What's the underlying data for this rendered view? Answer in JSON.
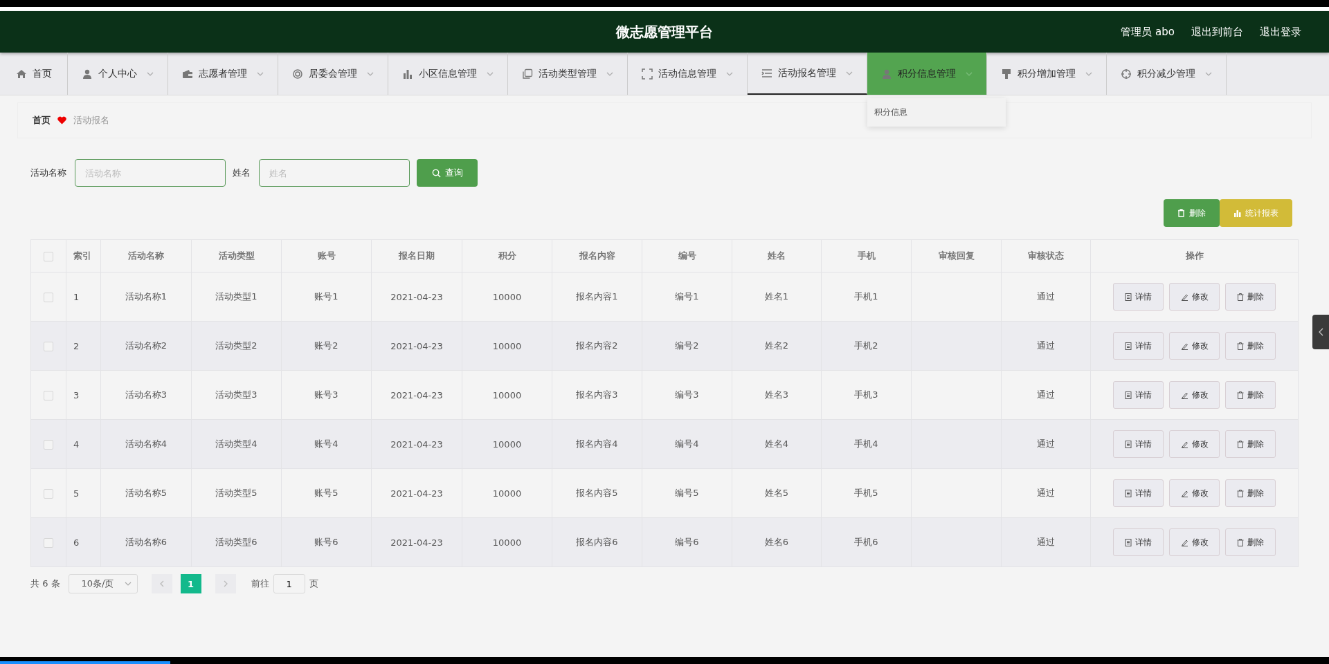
{
  "header": {
    "title": "微志愿管理平台",
    "user": "管理员 abo",
    "links": [
      "退出到前台",
      "退出登录"
    ]
  },
  "nav": [
    {
      "label": "首页",
      "has_caret": false,
      "selected": false,
      "highlighted": false
    },
    {
      "label": "个人中心",
      "has_caret": true,
      "selected": false,
      "highlighted": false
    },
    {
      "label": "志愿者管理",
      "has_caret": true,
      "selected": false,
      "highlighted": false
    },
    {
      "label": "居委会管理",
      "has_caret": true,
      "selected": false,
      "highlighted": false
    },
    {
      "label": "小区信息管理",
      "has_caret": true,
      "selected": false,
      "highlighted": false
    },
    {
      "label": "活动类型管理",
      "has_caret": true,
      "selected": false,
      "highlighted": false
    },
    {
      "label": "活动信息管理",
      "has_caret": true,
      "selected": false,
      "highlighted": false
    },
    {
      "label": "活动报名管理",
      "has_caret": true,
      "selected": true,
      "highlighted": false
    },
    {
      "label": "积分信息管理",
      "has_caret": true,
      "selected": false,
      "highlighted": true,
      "submenu": [
        "积分信息"
      ]
    },
    {
      "label": "积分增加管理",
      "has_caret": true,
      "selected": false,
      "highlighted": false
    },
    {
      "label": "积分减少管理",
      "has_caret": true,
      "selected": false,
      "highlighted": false
    }
  ],
  "breadcrumb": {
    "home": "首页",
    "current": "活动报名"
  },
  "search": {
    "fields": [
      {
        "label": "活动名称",
        "placeholder": "活动名称"
      },
      {
        "label": "姓名",
        "placeholder": "姓名"
      }
    ],
    "button": "查询"
  },
  "actions": [
    {
      "kind": "delete",
      "label": "删除"
    },
    {
      "kind": "report",
      "label": "统计报表"
    }
  ],
  "table": {
    "header_checked": false,
    "columns": [
      "索引",
      "活动名称",
      "活动类型",
      "账号",
      "报名日期",
      "积分",
      "报名内容",
      "编号",
      "姓名",
      "手机",
      "审核回复",
      "审核状态",
      "操作"
    ],
    "rows": [
      {
        "checked": false,
        "cells": [
          "1",
          "活动名称1",
          "活动类型1",
          "账号1",
          "2021-04-23",
          "10000",
          "报名内容1",
          "编号1",
          "姓名1",
          "手机1",
          "",
          "通过"
        ],
        "actions": [
          {
            "kind": "detail",
            "label": "详情"
          },
          {
            "kind": "edit",
            "label": "修改"
          },
          {
            "kind": "delete",
            "label": "删除"
          }
        ]
      },
      {
        "checked": false,
        "cells": [
          "2",
          "活动名称2",
          "活动类型2",
          "账号2",
          "2021-04-23",
          "10000",
          "报名内容2",
          "编号2",
          "姓名2",
          "手机2",
          "",
          "通过"
        ],
        "actions": [
          {
            "kind": "detail",
            "label": "详情"
          },
          {
            "kind": "edit",
            "label": "修改"
          },
          {
            "kind": "delete",
            "label": "删除"
          }
        ]
      },
      {
        "checked": false,
        "cells": [
          "3",
          "活动名称3",
          "活动类型3",
          "账号3",
          "2021-04-23",
          "10000",
          "报名内容3",
          "编号3",
          "姓名3",
          "手机3",
          "",
          "通过"
        ],
        "actions": [
          {
            "kind": "detail",
            "label": "详情"
          },
          {
            "kind": "edit",
            "label": "修改"
          },
          {
            "kind": "delete",
            "label": "删除"
          }
        ]
      },
      {
        "checked": false,
        "cells": [
          "4",
          "活动名称4",
          "活动类型4",
          "账号4",
          "2021-04-23",
          "10000",
          "报名内容4",
          "编号4",
          "姓名4",
          "手机4",
          "",
          "通过"
        ],
        "actions": [
          {
            "kind": "detail",
            "label": "详情"
          },
          {
            "kind": "edit",
            "label": "修改"
          },
          {
            "kind": "delete",
            "label": "删除"
          }
        ]
      },
      {
        "checked": false,
        "cells": [
          "5",
          "活动名称5",
          "活动类型5",
          "账号5",
          "2021-04-23",
          "10000",
          "报名内容5",
          "编号5",
          "姓名5",
          "手机5",
          "",
          "通过"
        ],
        "actions": [
          {
            "kind": "detail",
            "label": "详情"
          },
          {
            "kind": "edit",
            "label": "修改"
          },
          {
            "kind": "delete",
            "label": "删除"
          }
        ]
      },
      {
        "checked": false,
        "cells": [
          "6",
          "活动名称6",
          "活动类型6",
          "账号6",
          "2021-04-23",
          "10000",
          "报名内容6",
          "编号6",
          "姓名6",
          "手机6",
          "",
          "通过"
        ],
        "actions": [
          {
            "kind": "detail",
            "label": "详情"
          },
          {
            "kind": "edit",
            "label": "修改"
          },
          {
            "kind": "delete",
            "label": "删除"
          }
        ]
      }
    ]
  },
  "video_bar": {
    "level": 0.128
  },
  "pagination": {
    "total": "共 6 条",
    "page_size": "10条/页",
    "pages": [
      {
        "label": "1",
        "selected": true
      }
    ],
    "goto_label": "前往",
    "goto_value": "1",
    "goto_unit": "页"
  }
}
